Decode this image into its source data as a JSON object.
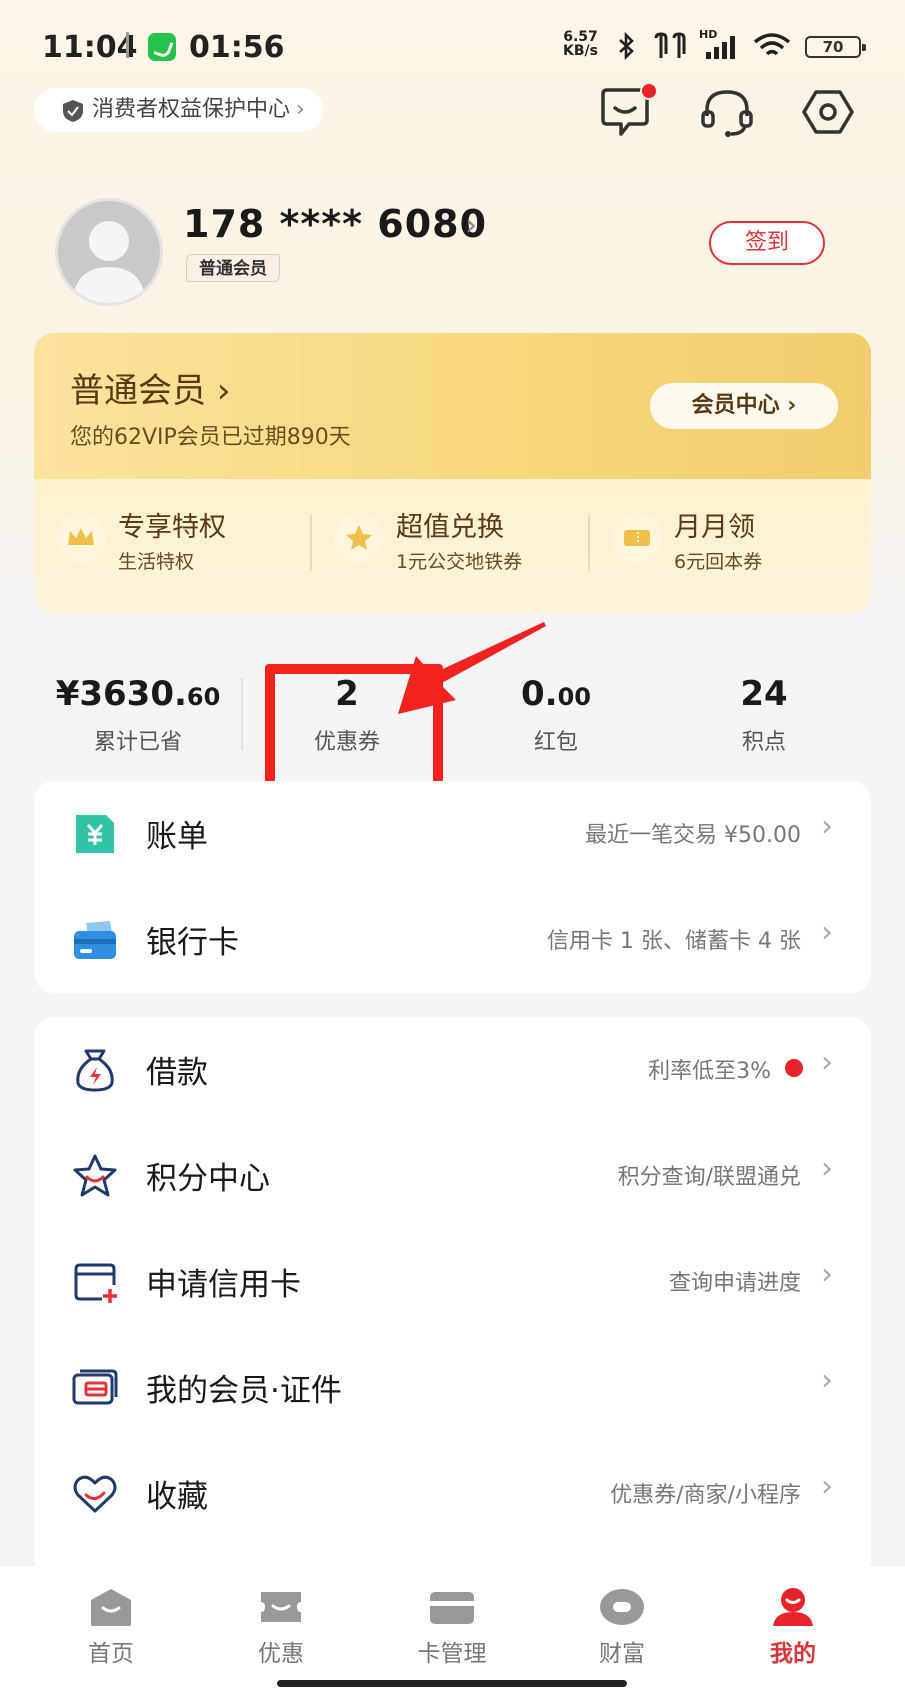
{
  "status_bar": {
    "time": "11:04",
    "call_time": "01:56",
    "net_speed_value": "6.57",
    "net_speed_unit": "KB/s",
    "net_type": "HD",
    "battery": "70"
  },
  "header": {
    "consumer_center": "消费者权益保护中心",
    "icons": [
      "message-icon",
      "headset-icon",
      "settings-icon"
    ]
  },
  "profile": {
    "phone": "178 **** 6080",
    "level": "普通会员",
    "checkin_label": "签到"
  },
  "vip_card": {
    "title": "普通会员",
    "subtitle": "您的62VIP会员已过期890天",
    "center_button": "会员中心",
    "perks": [
      {
        "title": "专享特权",
        "subtitle": "生活特权",
        "icon": "crown-icon"
      },
      {
        "title": "超值兑换",
        "subtitle": "1元公交地铁券",
        "icon": "star-icon"
      },
      {
        "title": "月月领",
        "subtitle": "6元回本券",
        "icon": "ticket-icon"
      }
    ]
  },
  "stats": [
    {
      "value_main": "¥3630.",
      "value_small": "60",
      "label": "累计已省"
    },
    {
      "value_main": "2",
      "value_small": "",
      "label": "优惠券"
    },
    {
      "value_main": "0.",
      "value_small": "00",
      "label": "红包"
    },
    {
      "value_main": "24",
      "value_small": "",
      "label": "积点"
    }
  ],
  "list_group_1": [
    {
      "label": "账单",
      "desc": "最近一笔交易 ¥50.00",
      "icon": "bill-icon"
    },
    {
      "label": "银行卡",
      "desc": "信用卡 1 张、储蓄卡 4 张",
      "icon": "bank-card-icon"
    }
  ],
  "list_group_2": [
    {
      "label": "借款",
      "desc": "利率低至3%",
      "icon": "loan-bag-icon"
    },
    {
      "label": "积分中心",
      "desc": "积分查询/联盟通兑",
      "icon": "points-star-icon"
    },
    {
      "label": "申请信用卡",
      "desc": "查询申请进度",
      "icon": "apply-card-icon"
    },
    {
      "label": "我的会员·证件",
      "desc": "",
      "icon": "member-card-icon"
    },
    {
      "label": "收藏",
      "desc": "优惠券/商家/小程序",
      "icon": "favorite-heart-icon"
    }
  ],
  "bottom_nav": [
    {
      "label": "首页",
      "active": false
    },
    {
      "label": "优惠",
      "active": false
    },
    {
      "label": "卡管理",
      "active": false
    },
    {
      "label": "财富",
      "active": false
    },
    {
      "label": "我的",
      "active": true
    }
  ],
  "colors": {
    "accent_red": "#d9343a",
    "highlight_red": "#f2231f",
    "gold": "#f7d77b",
    "gold_text": "#5a3a13"
  }
}
